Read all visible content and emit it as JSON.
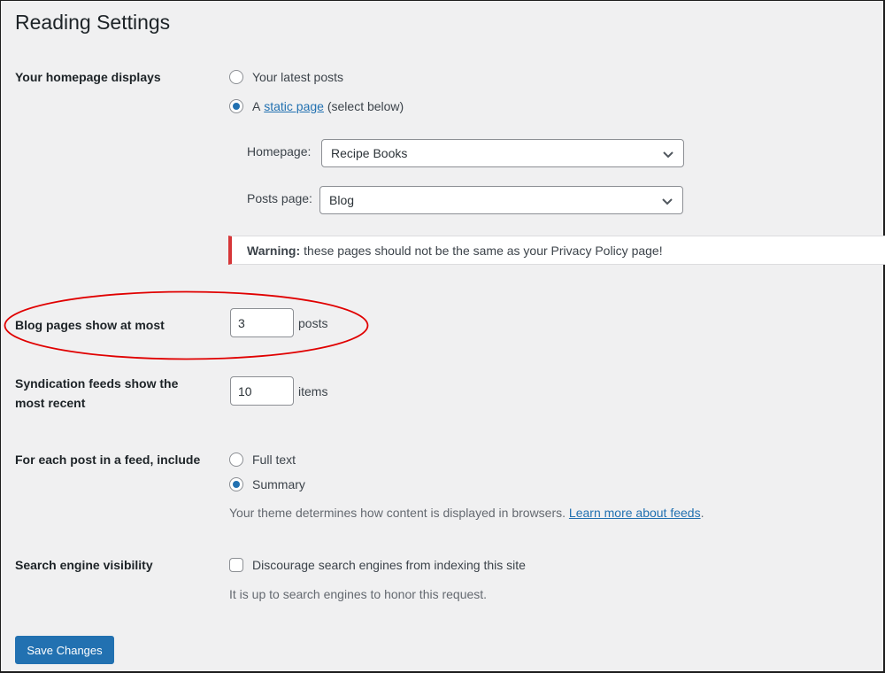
{
  "page": {
    "title": "Reading Settings"
  },
  "homepage_displays": {
    "label": "Your homepage displays",
    "options": [
      {
        "label": "Your latest posts",
        "selected": false
      },
      {
        "label_prefix": "A",
        "link": "static page",
        "label_suffix": "(select below)",
        "selected": true
      }
    ],
    "homepage_select": {
      "label": "Homepage:",
      "value": "Recipe Books"
    },
    "posts_page_select": {
      "label": "Posts page:",
      "value": "Blog"
    },
    "warning": {
      "strong": "Warning:",
      "text": "these pages should not be the same as your Privacy Policy page!"
    }
  },
  "blog_pages": {
    "label": "Blog pages show at most",
    "value": "3",
    "unit": "posts",
    "highlighted": true
  },
  "syndication": {
    "label_line1": "Syndication feeds show the",
    "label_line2": "most recent",
    "value": "10",
    "unit": "items"
  },
  "feed_include": {
    "label": "For each post in a feed, include",
    "options": [
      {
        "label": "Full text",
        "selected": false
      },
      {
        "label": "Summary",
        "selected": true
      }
    ],
    "description": "Your theme determines how content is displayed in browsers.",
    "learn_more_link": "Learn more about feeds",
    "trailing": "."
  },
  "search_visibility": {
    "label": "Search engine visibility",
    "checkbox_label": "Discourage search engines from indexing this site",
    "checked": false,
    "description": "It is up to search engines to honor this request."
  },
  "actions": {
    "save_label": "Save Changes"
  },
  "colors": {
    "accent": "#2271b1",
    "warning_border": "#d63638",
    "annotation": "#e00000",
    "background": "#f0f0f1"
  }
}
